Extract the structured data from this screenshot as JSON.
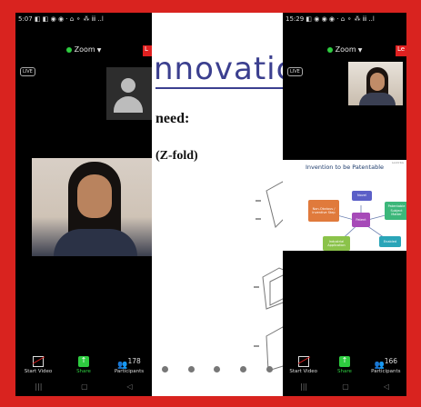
{
  "left_phone": {
    "status_time": "5:07",
    "status_icons": "◧ ◧ ◉ ◉ · ⌂ ⚬ ⁂ ⅲ ..l",
    "app_title": "Zoom",
    "leave_label": "L",
    "live_label": "LIVE",
    "toolbar": {
      "start_video": "Start Video",
      "share": "Share",
      "participants": "Participants",
      "participants_count": "178"
    }
  },
  "right_phone": {
    "status_time": "15:29",
    "status_icons": "◧ ◉ ◉ ◉ · ⌂ ⚬ ⁂ ⅲ ..l",
    "app_title": "Zoom",
    "leave_label": "Le",
    "live_label": "LIVE",
    "toolbar": {
      "start_video": "Start Video",
      "share": "Share",
      "participants": "Participants",
      "participants_count": "166"
    }
  },
  "slide": {
    "title": "nnovatic",
    "line1": "need:",
    "line2": "(Z-fold)"
  },
  "diagram": {
    "title": "Invention to be Patentable",
    "corner_note": "LexOrbis",
    "nodes": {
      "novel": "Novel",
      "non_obvious": "Non-Obvious / Inventive Step",
      "patent": "Patent",
      "patentable": "Patentable Subject Matter",
      "industrial": "Industrial Application",
      "enabled": "Enabled"
    }
  },
  "nav": {
    "menu": "|||",
    "home": "▢",
    "back": "◁"
  },
  "colors": {
    "frame": "#d9231f",
    "slide_title": "#3b3f8f",
    "share_green": "#2ecc40"
  }
}
